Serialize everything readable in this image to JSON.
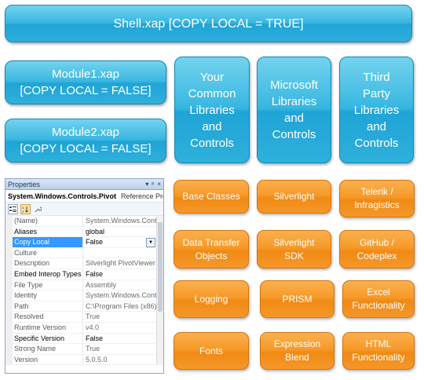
{
  "shell": "Shell.xap [COPY LOCAL = TRUE]",
  "modules": [
    "Module1.xap\n[COPY LOCAL = FALSE]",
    "Module2.xap\n[COPY LOCAL = FALSE]"
  ],
  "library_groups": [
    "Your\nCommon\nLibraries\nand\nControls",
    "Microsoft\nLibraries\nand\nControls",
    "Third\nParty\nLibraries\nand\nControls"
  ],
  "library_items": [
    [
      "Base Classes",
      "Silverlight",
      "Telerik /\nInfragistics"
    ],
    [
      "Data Transfer\nObjects",
      "Silverlight\nSDK",
      "GitHub /\nCodeplex"
    ],
    [
      "Logging",
      "PRISM",
      "Excel\nFunctionality"
    ],
    [
      "Fonts",
      "Expression\nBlend",
      "HTML\nFunctionality"
    ]
  ],
  "properties_panel": {
    "title": "Properties",
    "controls": [
      "▾",
      "ᵖ",
      "×"
    ],
    "object_name": "System.Windows.Controls.Pivot",
    "object_type": "Reference Prop",
    "toolbar_icons": [
      "categorized-icon",
      "alphabetical-icon",
      "wrench-icon"
    ],
    "rows": [
      {
        "name": "(Name)",
        "value": "System.Windows.Contr"
      },
      {
        "name": "Aliases",
        "value": "global"
      },
      {
        "name": "Copy Local",
        "value": "False"
      },
      {
        "name": "Culture",
        "value": ""
      },
      {
        "name": "Description",
        "value": "Silverlight PivotViewer"
      },
      {
        "name": "Embed Interop Types",
        "value": "False"
      },
      {
        "name": "File Type",
        "value": "Assembly"
      },
      {
        "name": "Identity",
        "value": "System.Windows.Contr"
      },
      {
        "name": "Path",
        "value": "C:\\Program Files (x86)\\"
      },
      {
        "name": "Resolved",
        "value": "True"
      },
      {
        "name": "Runtime Version",
        "value": "v4.0"
      },
      {
        "name": "Specific Version",
        "value": "False"
      },
      {
        "name": "Strong Name",
        "value": "True"
      },
      {
        "name": "Version",
        "value": "5.0.5.0"
      }
    ]
  },
  "colors": {
    "blue_box": "#2fb0dc",
    "orange_box": "#f69a2a"
  }
}
